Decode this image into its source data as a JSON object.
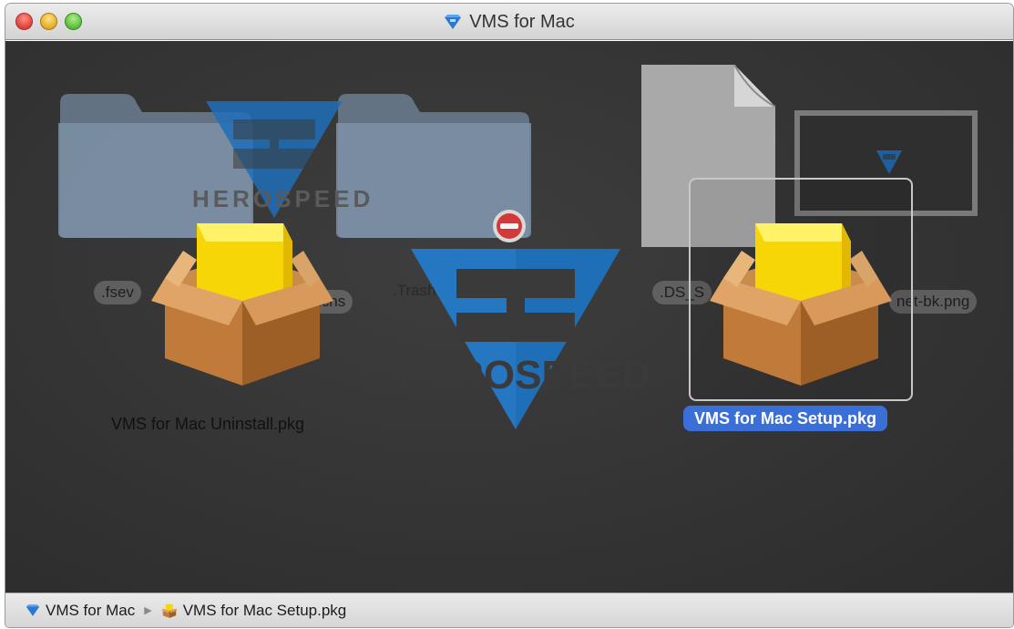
{
  "window": {
    "title": "VMS for Mac"
  },
  "files": {
    "ghost_fseventsd": ".fsev",
    "ghost_icns": "icns",
    "ghost_trashes": ".Trashes",
    "ghost_ds_store": ".DS_S",
    "ghost_png": "net-bk.png",
    "uninstall": "VMS for Mac Uninstall.pkg",
    "setup": "VMS for Mac Setup.pkg"
  },
  "watermark": {
    "brand_small": "HEROSPEED",
    "brand_large": "HEROSPEED"
  },
  "pathbar": {
    "crumbs": [
      "VMS for Mac",
      "VMS for Mac Setup.pkg"
    ]
  },
  "colors": {
    "background": "#353535",
    "selection": "#3a6fd8",
    "logo_blue": "#1e6fb8",
    "box_yellow": "#f5d50a",
    "box_brown": "#b87333"
  },
  "icons": [
    "volume-icon",
    "folder-icon",
    "document-icon",
    "package-icon",
    "no-entry-icon",
    "herospeed-logo"
  ]
}
